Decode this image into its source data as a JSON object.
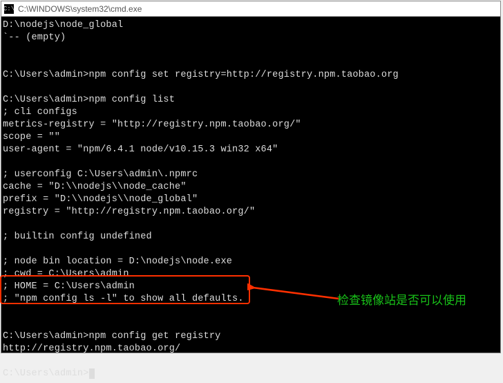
{
  "titlebar": {
    "icon_glyph": "C:\\",
    "title": "C:\\WINDOWS\\system32\\cmd.exe"
  },
  "terminal": {
    "lines": [
      "D:\\nodejs\\node_global",
      "`-- (empty)",
      "",
      "",
      "C:\\Users\\admin>npm config set registry=http://registry.npm.taobao.org",
      "",
      "C:\\Users\\admin>npm config list",
      "; cli configs",
      "metrics-registry = \"http://registry.npm.taobao.org/\"",
      "scope = \"\"",
      "user-agent = \"npm/6.4.1 node/v10.15.3 win32 x64\"",
      "",
      "; userconfig C:\\Users\\admin\\.npmrc",
      "cache = \"D:\\\\nodejs\\\\node_cache\"",
      "prefix = \"D:\\\\nodejs\\\\node_global\"",
      "registry = \"http://registry.npm.taobao.org/\"",
      "",
      "; builtin config undefined",
      "",
      "; node bin location = D:\\nodejs\\node.exe",
      "; cwd = C:\\Users\\admin",
      "; HOME = C:\\Users\\admin",
      "; \"npm config ls -l\" to show all defaults.",
      "",
      "",
      "C:\\Users\\admin>npm config get registry",
      "http://registry.npm.taobao.org/",
      "",
      "C:\\Users\\admin>"
    ]
  },
  "annotation": {
    "text": "检查镜像站是否可以使用"
  }
}
